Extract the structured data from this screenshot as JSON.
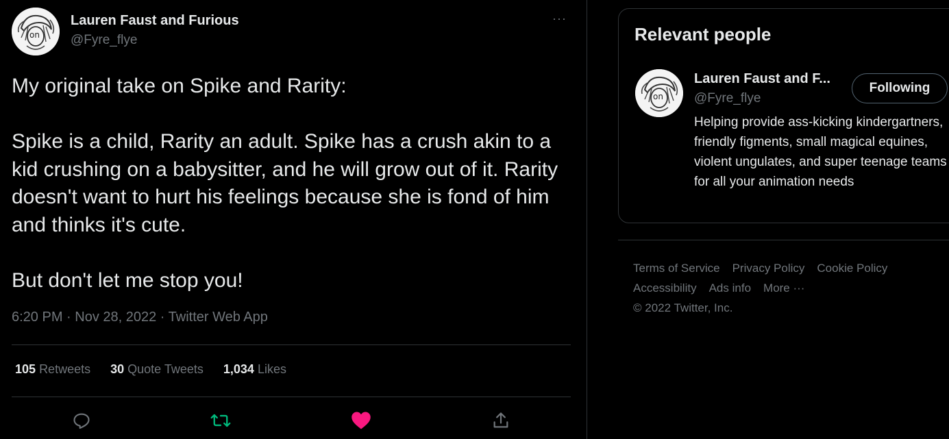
{
  "tweet": {
    "author_name": "Lauren Faust and Furious",
    "author_handle": "@Fyre_flye",
    "more_label": "···",
    "text": "My original take on Spike and Rarity:\n\nSpike is a child, Rarity an adult. Spike has a crush akin to a kid crushing on a babysitter, and he will grow out of it. Rarity doesn't want to hurt his feelings because she is fond of him and thinks it's cute.\n\nBut don't let me stop you!",
    "timestamp": "6:20 PM · Nov 28, 2022 · Twitter Web App",
    "stats": {
      "retweets_count": "105",
      "retweets_label": "Retweets",
      "quotes_count": "30",
      "quotes_label": "Quote Tweets",
      "likes_count": "1,034",
      "likes_label": "Likes"
    },
    "actions": [
      {
        "icon": "reply-icon",
        "color": "#71767b"
      },
      {
        "icon": "retweet-icon",
        "color": "#00ba7c"
      },
      {
        "icon": "heart-icon",
        "color": "#f91880"
      },
      {
        "icon": "share-icon",
        "color": "#71767b"
      }
    ]
  },
  "relevant_people": {
    "title": "Relevant people",
    "person": {
      "name": "Lauren Faust and F...",
      "handle": "@Fyre_flye",
      "follow_label": "Following",
      "bio": "Helping provide ass-kicking kindergartners, friendly figments, small magical equines, violent ungulates, and super teenage teams for all your animation needs"
    }
  },
  "footer": {
    "terms": "Terms of Service",
    "privacy": "Privacy Policy",
    "cookie": "Cookie Policy",
    "accessibility": "Accessibility",
    "ads": "Ads info",
    "more": "More ···",
    "copyright": "© 2022 Twitter, Inc."
  },
  "colors": {
    "background": "#000000",
    "text_primary": "#e7e9ea",
    "text_secondary": "#71767b",
    "border": "#2f3336",
    "like_pink": "#f91880",
    "retweet_green": "#00ba7c"
  }
}
